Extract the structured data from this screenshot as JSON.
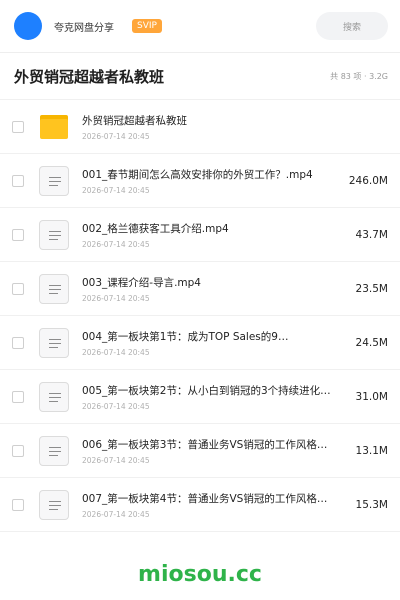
{
  "header": {
    "username": "夸克网盘分享",
    "badge": "SVIP",
    "search_label": "搜索"
  },
  "folder": {
    "title": "外贸销冠超越者私教班",
    "meta": "共 83 项 · 3.2G"
  },
  "items": [
    {
      "icon": "folder-icon",
      "name": "外贸销冠超越者私教班",
      "date": "2026-07-14 20:45",
      "size": ""
    },
    {
      "icon": "video-file-icon",
      "name": "001_春节期间怎么高效安排你的外贸工作？.mp4",
      "date": "2026-07-14 20:45",
      "size": "246.0M"
    },
    {
      "icon": "video-file-icon",
      "name": "002_格兰德获客工具介绍.mp4",
      "date": "2026-07-14 20:45",
      "size": "43.7M"
    },
    {
      "icon": "video-file-icon",
      "name": "003_课程介绍-导言.mp4",
      "date": "2026-07-14 20:45",
      "size": "23.5M"
    },
    {
      "icon": "video-file-icon",
      "name": "004_第一板块第1节：成为TOP Sales的9…",
      "date": "2026-07-14 20:45",
      "size": "24.5M"
    },
    {
      "icon": "video-file-icon",
      "name": "005_第一板块第2节：从小白到销冠的3个持续进化…",
      "date": "2026-07-14 20:45",
      "size": "31.0M"
    },
    {
      "icon": "video-file-icon",
      "name": "006_第一板块第3节：普通业务VS销冠的工作风格…",
      "date": "2026-07-14 20:45",
      "size": "13.1M"
    },
    {
      "icon": "video-file-icon",
      "name": "007_第一板块第4节：普通业务VS销冠的工作风格…",
      "date": "2026-07-14 20:45",
      "size": "15.3M"
    }
  ],
  "watermark": "miosou.cc"
}
